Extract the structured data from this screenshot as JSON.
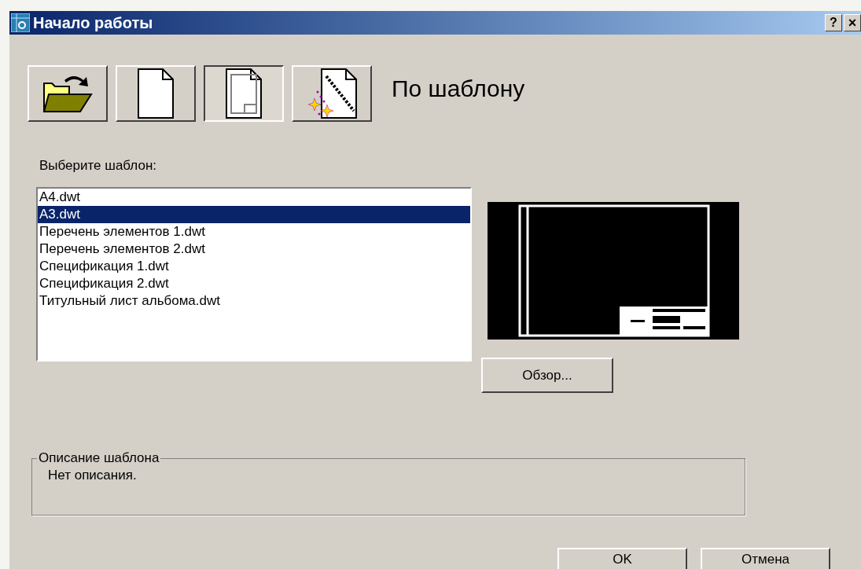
{
  "window": {
    "title": "Начало работы",
    "help_button": "?",
    "close_button": "×"
  },
  "tabs": [
    {
      "kind": "open",
      "selected": false
    },
    {
      "kind": "blank",
      "selected": false
    },
    {
      "kind": "template",
      "selected": true
    },
    {
      "kind": "wizard",
      "selected": false
    }
  ],
  "heading": "По шаблону",
  "list_label": "Выберите шаблон:",
  "templates": [
    {
      "name": "A4.dwt",
      "selected": false
    },
    {
      "name": "A3.dwt",
      "selected": true
    },
    {
      "name": "Перечень элементов 1.dwt",
      "selected": false
    },
    {
      "name": "Перечень элементов 2.dwt",
      "selected": false
    },
    {
      "name": "Спецификация 1.dwt",
      "selected": false
    },
    {
      "name": "Спецификация 2.dwt",
      "selected": false
    },
    {
      "name": "Титульный лист альбома.dwt",
      "selected": false
    }
  ],
  "browse_button": "Обзор...",
  "description": {
    "legend": "Описание шаблона",
    "text": "Нет описания."
  },
  "buttons": [
    "OK",
    "Отмена"
  ]
}
